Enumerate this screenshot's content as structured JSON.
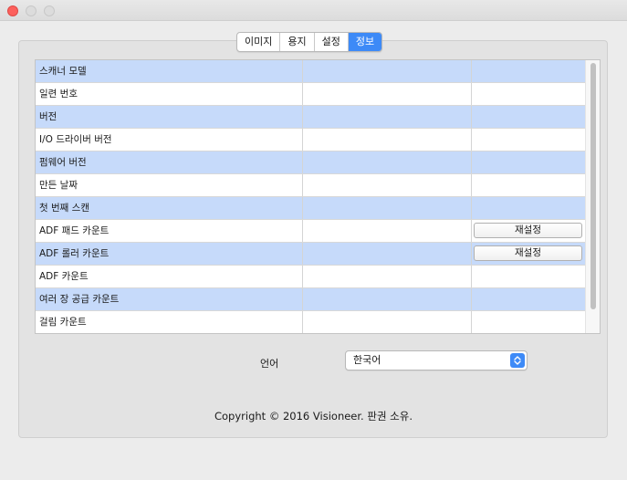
{
  "window": {
    "controls": [
      "close-icon",
      "minimize-icon",
      "zoom-icon"
    ]
  },
  "tabs": [
    {
      "label": "이미지",
      "active": false
    },
    {
      "label": "용지",
      "active": false
    },
    {
      "label": "설정",
      "active": false
    },
    {
      "label": "정보",
      "active": true
    }
  ],
  "info_table": {
    "rows": [
      {
        "label": "스캐너 모델",
        "value": "",
        "extra": "",
        "button": null
      },
      {
        "label": "일련 번호",
        "value": "",
        "extra": "",
        "button": null
      },
      {
        "label": "버전",
        "value": "",
        "extra": "",
        "button": null
      },
      {
        "label": "I/O 드라이버 버전",
        "value": "",
        "extra": "",
        "button": null
      },
      {
        "label": "펌웨어 버전",
        "value": "",
        "extra": "",
        "button": null
      },
      {
        "label": "만든 날짜",
        "value": "",
        "extra": "",
        "button": null
      },
      {
        "label": "첫 번째 스캔",
        "value": "",
        "extra": "",
        "button": null
      },
      {
        "label": "ADF 패드 카운트",
        "value": "",
        "extra": "",
        "button": "재설정"
      },
      {
        "label": "ADF 롤러 카운트",
        "value": "",
        "extra": "",
        "button": "재설정"
      },
      {
        "label": "ADF 카운트",
        "value": "",
        "extra": "",
        "button": null
      },
      {
        "label": "여러 장 공급 카운트",
        "value": "",
        "extra": "",
        "button": null
      },
      {
        "label": "걸림 카운트",
        "value": "",
        "extra": "",
        "button": null
      }
    ]
  },
  "language": {
    "label": "언어",
    "selected": "한국어"
  },
  "footer": {
    "copyright": "Copyright © 2016 Visioneer. 판권 소유."
  },
  "colors": {
    "accent": "#3d8af7",
    "row_highlight": "#c6dafa",
    "close_button": "#fc605c",
    "window_bg": "#ececec"
  }
}
